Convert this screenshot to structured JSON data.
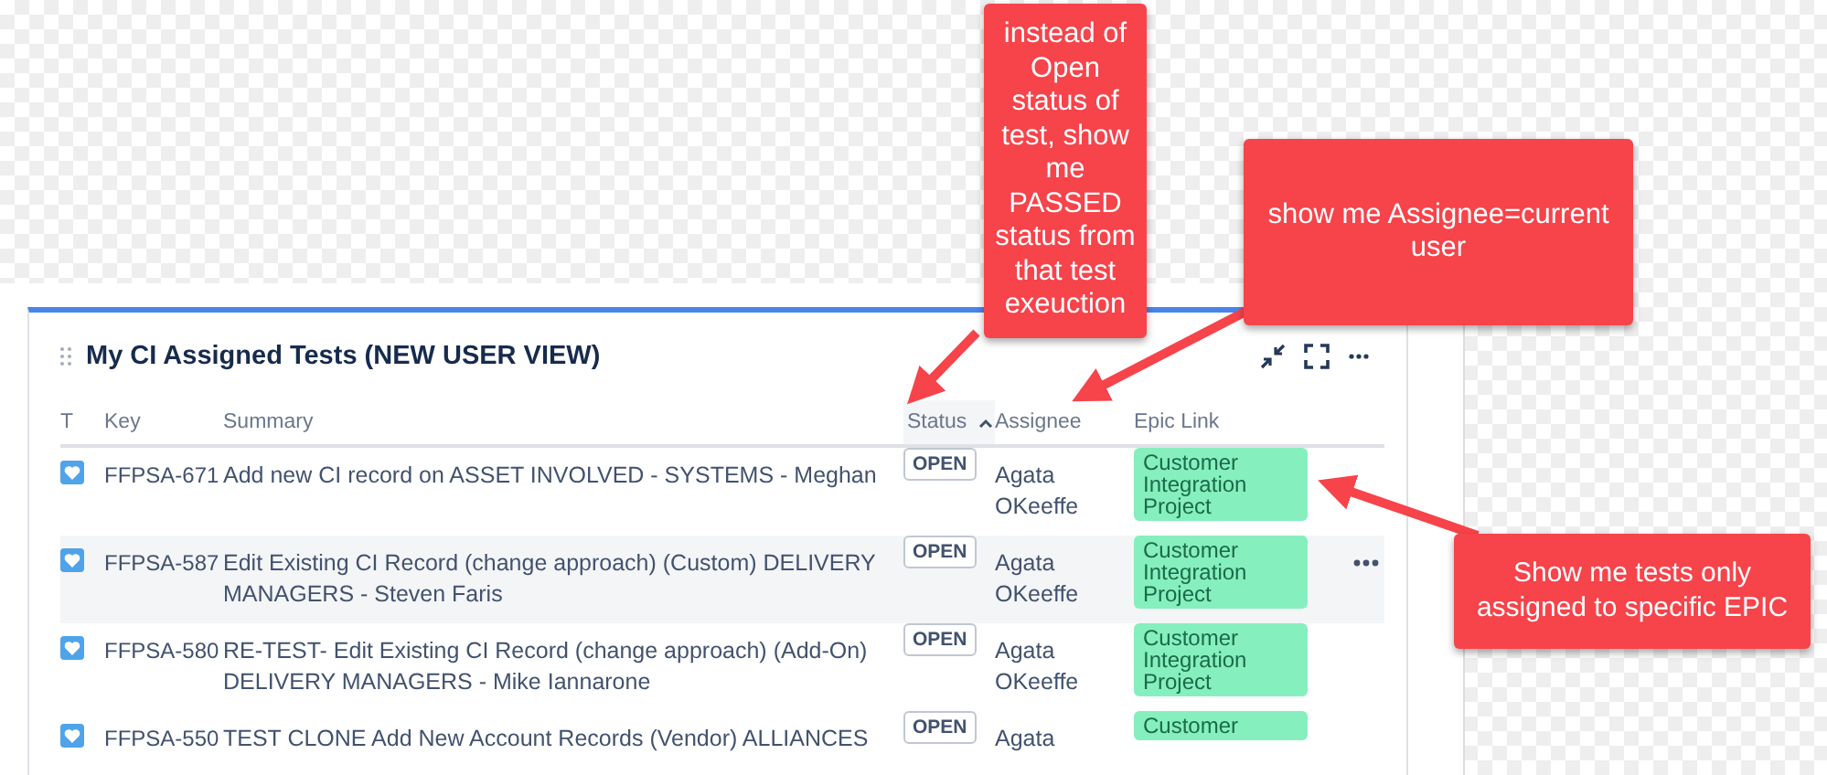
{
  "panel": {
    "title": "My CI Assigned Tests (NEW USER VIEW)"
  },
  "table": {
    "columns": [
      {
        "label": "T",
        "sorted": false
      },
      {
        "label": "Key",
        "sorted": false
      },
      {
        "label": "Summary",
        "sorted": false
      },
      {
        "label": "Status",
        "sorted": true
      },
      {
        "label": "Assignee",
        "sorted": false
      },
      {
        "label": "Epic Link",
        "sorted": false
      }
    ],
    "rows": [
      {
        "key": "FFPSA-671",
        "summary": "Add new CI record on ASSET INVOLVED - SYSTEMS - Meghan",
        "status": "OPEN",
        "assignee": "Agata OKeeffe",
        "epic": "Customer Integration Project",
        "hovered": false
      },
      {
        "key": "FFPSA-587",
        "summary": "Edit Existing CI Record (change approach) (Custom) DELIVERY MANAGERS - Steven Faris",
        "status": "OPEN",
        "assignee": "Agata OKeeffe",
        "epic": "Customer Integration Project",
        "hovered": true
      },
      {
        "key": "FFPSA-580",
        "summary": "RE-TEST- Edit Existing CI Record (change approach) (Add-On) DELIVERY MANAGERS - Mike Iannarone",
        "status": "OPEN",
        "assignee": "Agata OKeeffe",
        "epic": "Customer Integration Project",
        "hovered": false
      },
      {
        "key": "FFPSA-550",
        "summary": "TEST CLONE Add New Account Records (Vendor) ALLIANCES",
        "status": "OPEN",
        "assignee": "Agata",
        "epic": "Customer",
        "hovered": false
      }
    ]
  },
  "annotations": [
    {
      "text": "instead of Open status of test, show me PASSED status from that test exeuction"
    },
    {
      "text": "show me Assignee=current user"
    },
    {
      "text": "Show me tests only assigned to specific EPIC"
    }
  ]
}
